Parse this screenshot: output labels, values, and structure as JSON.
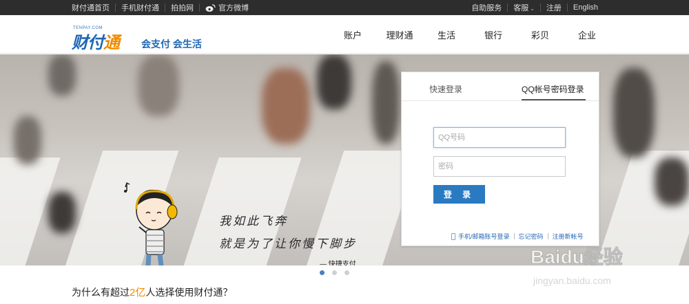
{
  "topbar": {
    "left_links": [
      "财付通首页",
      "手机财付通",
      "拍拍网"
    ],
    "weibo": "官方微博",
    "right_links": {
      "self_service": "自助服务",
      "service": "客服",
      "register": "注册",
      "english": "English"
    }
  },
  "logo": {
    "en": "TENPAY.COM",
    "cn_a": "财付",
    "cn_b": "通",
    "slogan": "会支付 会生活"
  },
  "nav": [
    "账户",
    "理财通",
    "生活",
    "银行",
    "彩贝",
    "企业"
  ],
  "banner": {
    "tagline_line1": "我如此飞奔",
    "tagline_line2": "就是为了让你慢下脚步",
    "signature": "— 快捷支付"
  },
  "login": {
    "tab_quick": "快速登录",
    "tab_qq": "QQ帐号密码登录",
    "qq_placeholder": "QQ号码",
    "password_placeholder": "密码",
    "submit": "登 录",
    "link_phone": "手机/邮箱账号登录",
    "link_forgot": "忘记密码",
    "link_register": "注册新帐号"
  },
  "carousel": {
    "count": 3,
    "active": 0
  },
  "question": {
    "prefix": "为什么有超过",
    "highlight": "2亿",
    "suffix": "人选择使用财付通？"
  },
  "watermark": {
    "main": "Baidu经验",
    "sub": "jingyan.baidu.com"
  },
  "colors": {
    "accent": "#2a7ac2",
    "highlight": "#f18b00",
    "topbar": "#2d2d2d"
  }
}
